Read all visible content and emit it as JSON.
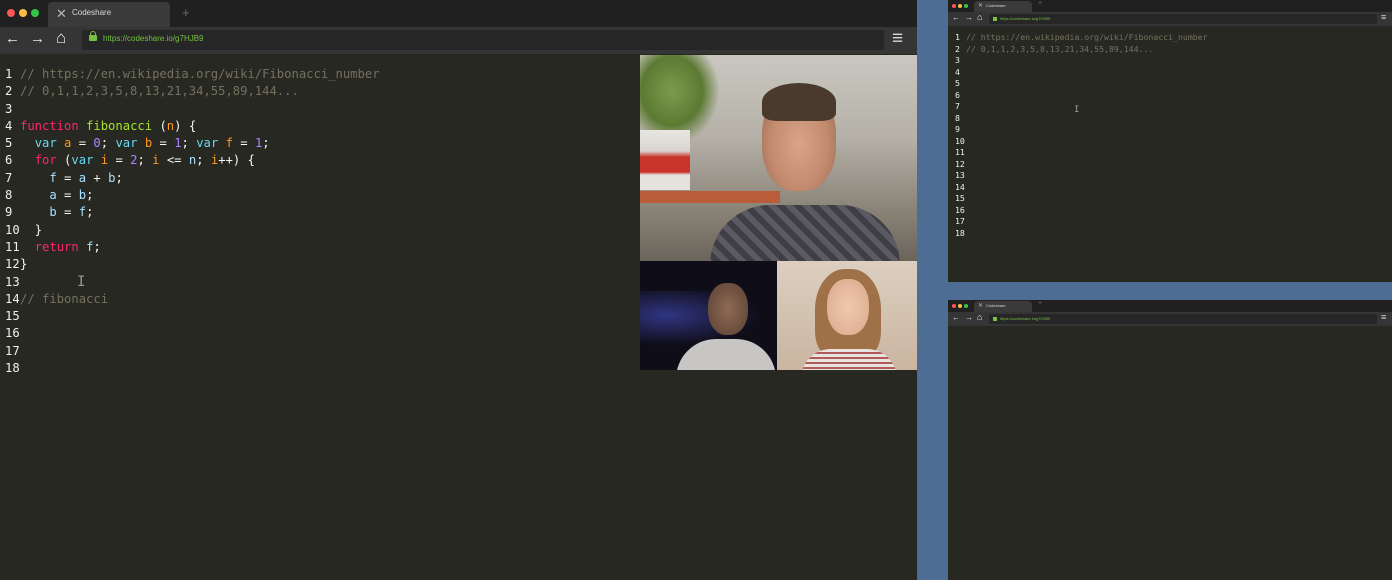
{
  "main_window": {
    "tab_title": "Codeshare",
    "url": "https://codeshare.io/g7HJB9",
    "code_lines": [
      {
        "n": "1",
        "text": "// https://en.wikipedia.org/wiki/Fibonacci_number"
      },
      {
        "n": "2",
        "text": "// 0,1,1,2,3,5,8,13,21,34,55,89,144..."
      },
      {
        "n": "3",
        "text": ""
      },
      {
        "n": "4",
        "text": "function fibonacci (n) {"
      },
      {
        "n": "5",
        "text": "  var a = 0; var b = 1; var f = 1;"
      },
      {
        "n": "6",
        "text": "  for (var i = 2; i <= n; i++) {"
      },
      {
        "n": "7",
        "text": "    f = a + b;"
      },
      {
        "n": "8",
        "text": "    a = b;"
      },
      {
        "n": "9",
        "text": "    b = f;"
      },
      {
        "n": "10",
        "text": "  }"
      },
      {
        "n": "11",
        "text": "  return f;"
      },
      {
        "n": "12",
        "text": "}"
      },
      {
        "n": "13",
        "text": ""
      },
      {
        "n": "14",
        "text": "// fibonacci"
      },
      {
        "n": "15",
        "text": ""
      },
      {
        "n": "16",
        "text": ""
      },
      {
        "n": "17",
        "text": ""
      },
      {
        "n": "18",
        "text": ""
      }
    ]
  },
  "side_window_top": {
    "tab_title": "Codeshare",
    "url": "https://codeshare.io/g7HJB9",
    "code_lines": [
      {
        "n": "1",
        "text": "// https://en.wikipedia.org/wiki/Fibonacci_number"
      },
      {
        "n": "2",
        "text": "// 0,1,1,2,3,5,8,13,21,34,55,89,144..."
      },
      {
        "n": "3",
        "text": ""
      },
      {
        "n": "4",
        "text": ""
      },
      {
        "n": "5",
        "text": ""
      },
      {
        "n": "6",
        "text": ""
      },
      {
        "n": "7",
        "text": ""
      },
      {
        "n": "8",
        "text": ""
      },
      {
        "n": "9",
        "text": ""
      },
      {
        "n": "10",
        "text": ""
      },
      {
        "n": "11",
        "text": ""
      },
      {
        "n": "12",
        "text": ""
      },
      {
        "n": "13",
        "text": ""
      },
      {
        "n": "14",
        "text": ""
      },
      {
        "n": "15",
        "text": ""
      },
      {
        "n": "16",
        "text": ""
      },
      {
        "n": "17",
        "text": ""
      },
      {
        "n": "18",
        "text": ""
      }
    ]
  },
  "side_window_bottom": {
    "tab_title": "Codeshare",
    "url": "https://codeshare.io/g7HJB9"
  },
  "icons": {
    "back": "←",
    "forward": "→",
    "home": "⌂",
    "menu": "≡",
    "new_tab": "+",
    "lock": "lock-icon",
    "codeshare": "✕"
  },
  "colors": {
    "editor_bg": "#272822",
    "comment": "#75715e",
    "keyword": "#f92672",
    "storage": "#66d9ef",
    "number": "#ae81ff",
    "param": "#fd971f",
    "function_name": "#a6e22e",
    "url_green": "#76c043",
    "desktop": "#4e6d95"
  }
}
